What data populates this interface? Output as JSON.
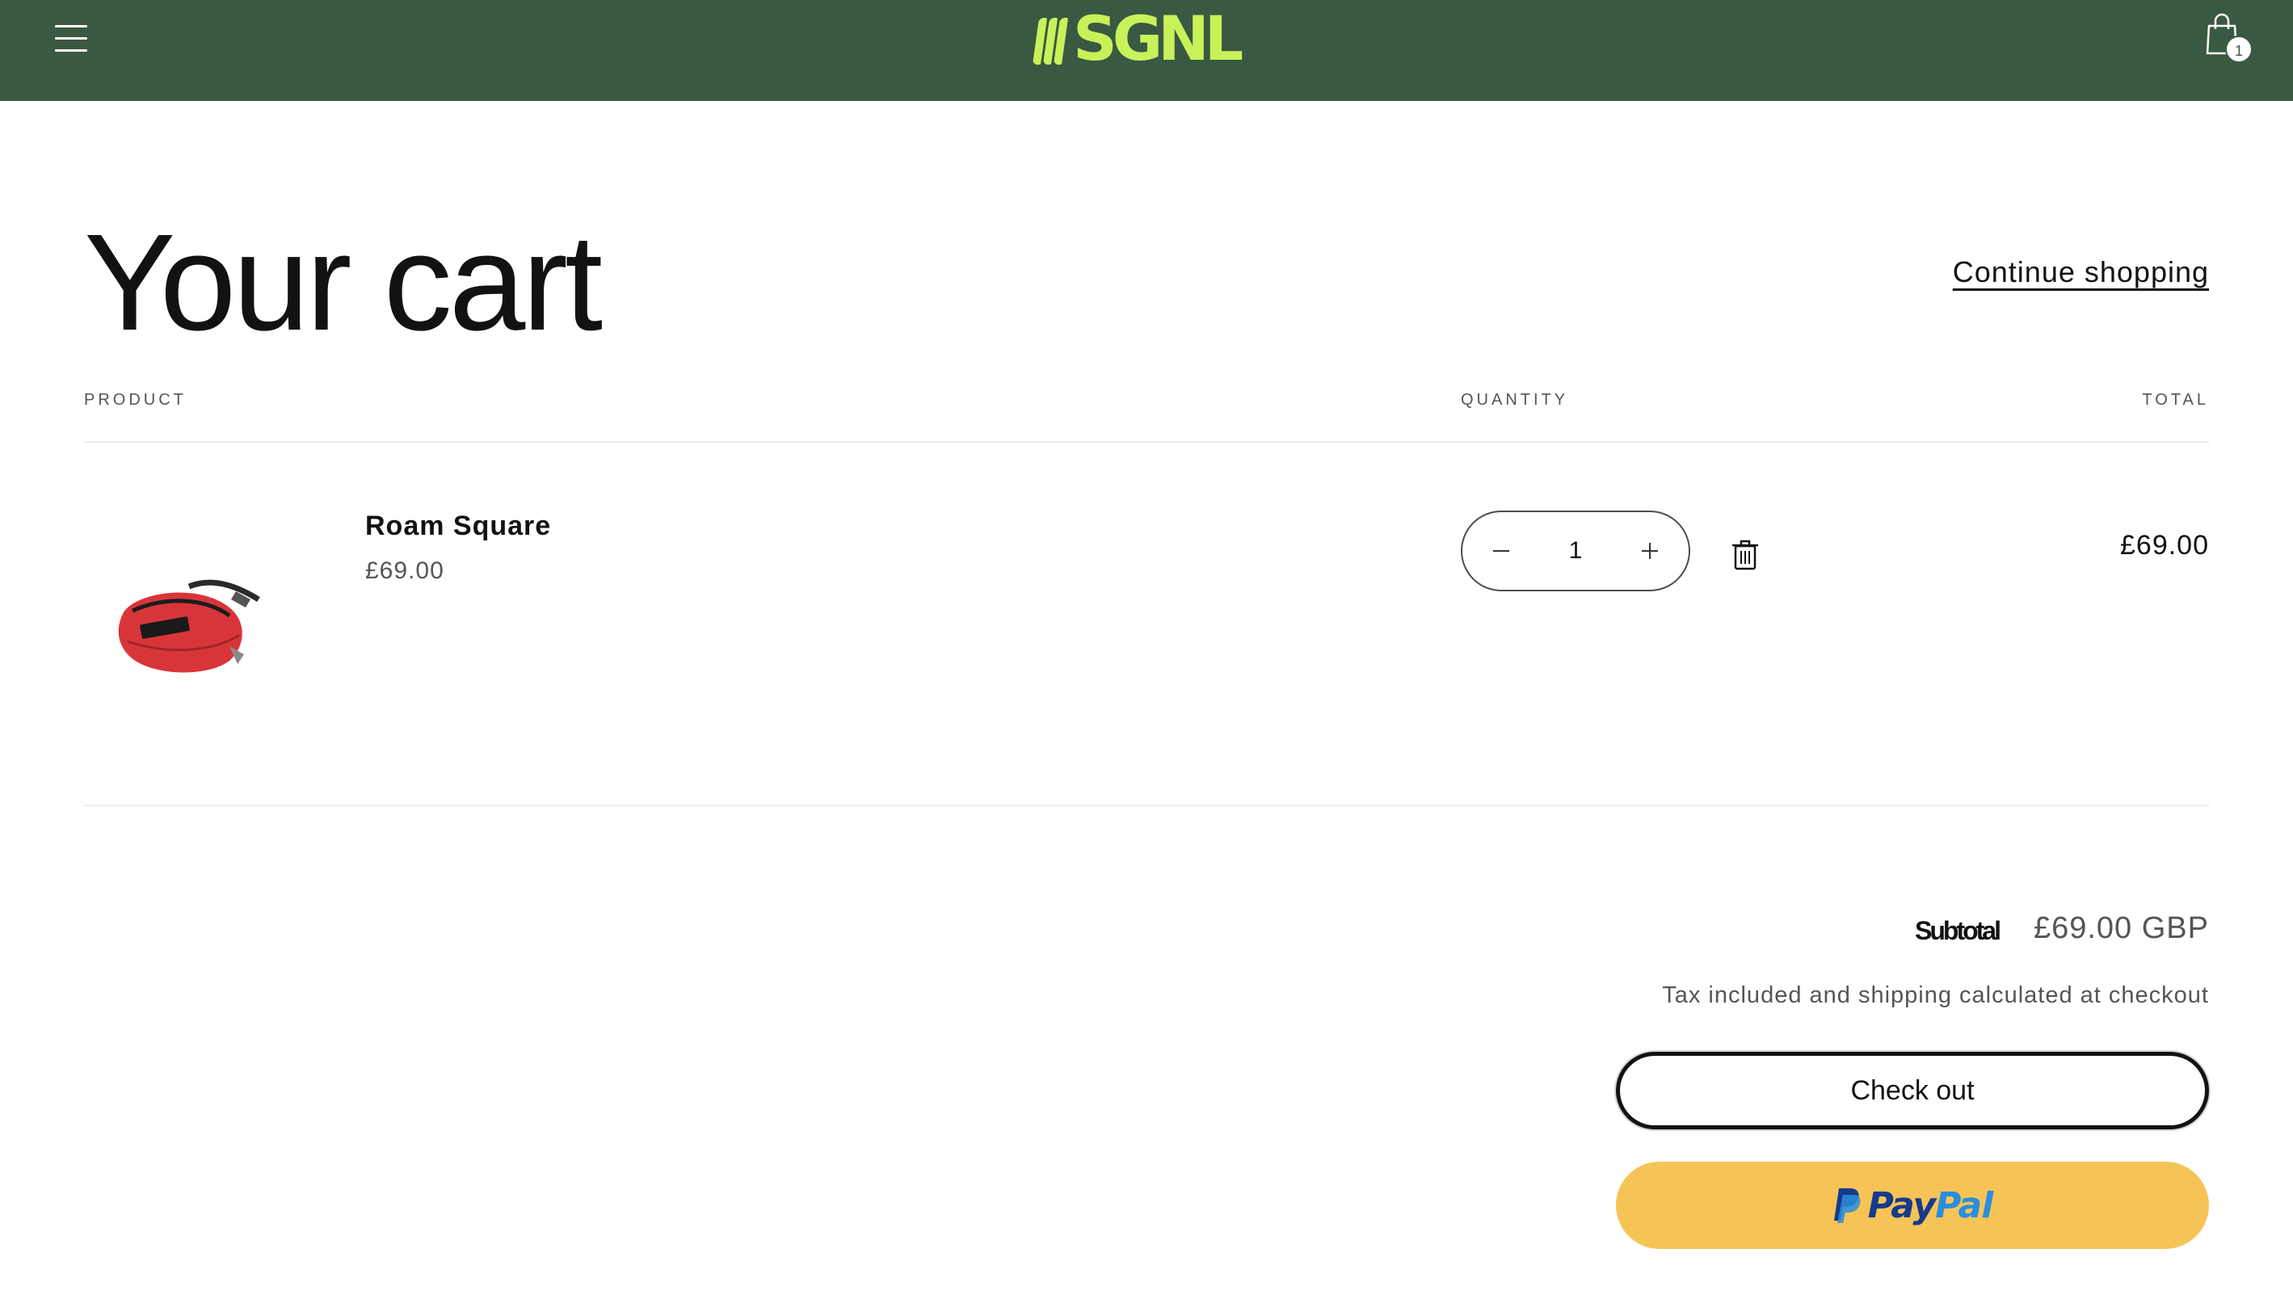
{
  "header": {
    "brand": "SGNL",
    "cart_count": "1",
    "colors": {
      "background": "#3a5942",
      "logo": "#c8f25a"
    },
    "icons": {
      "menu": "hamburger-menu-icon",
      "cart": "shopping-bag-icon"
    }
  },
  "page": {
    "title": "Your cart",
    "continue_link": "Continue shopping"
  },
  "table": {
    "headers": {
      "product": "PRODUCT",
      "quantity": "QUANTITY",
      "total": "TOTAL"
    },
    "items": [
      {
        "name": "Roam Square",
        "unit_price": "£69.00",
        "quantity": "1",
        "line_total": "£69.00",
        "image": "red-waist-bag-image"
      }
    ]
  },
  "summary": {
    "subtotal_label": "Subtotal",
    "subtotal_value": "£69.00 GBP",
    "tax_note": "Tax included and shipping calculated at checkout",
    "checkout_label": "Check out",
    "paypal_pay": "Pay",
    "paypal_pal": "Pal",
    "paypal_color": "#f6c456"
  }
}
